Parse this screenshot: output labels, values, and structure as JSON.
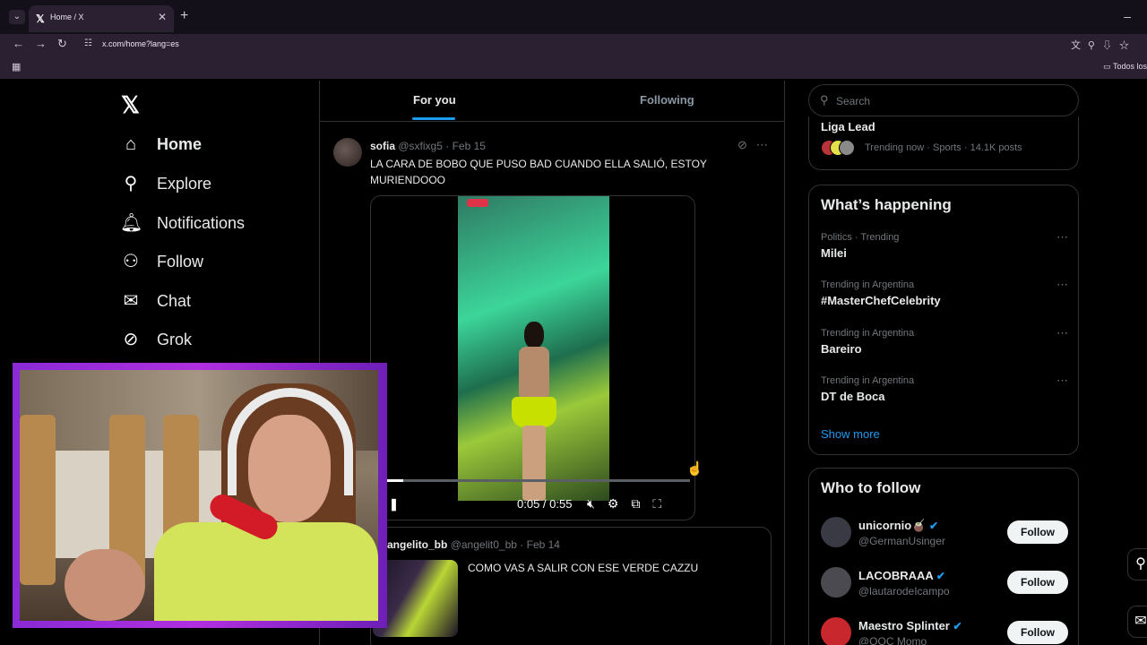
{
  "browser": {
    "tab_title": "Home / X",
    "tab_favicon": "𝕏",
    "url": "x.com/home?lang=es",
    "bookmark_folder": "Todos los",
    "icons": [
      "back-arrow-icon",
      "forward-arrow-icon",
      "reload-icon",
      "translate-icon",
      "zoom-icon",
      "install-icon",
      "star-icon",
      "apps-grid-icon",
      "folder-icon"
    ]
  },
  "nav": {
    "logo": "𝕏",
    "items": [
      {
        "label": "Home",
        "icon": "home-icon"
      },
      {
        "label": "Explore",
        "icon": "search-icon"
      },
      {
        "label": "Notifications",
        "icon": "bell-icon"
      },
      {
        "label": "Follow",
        "icon": "follow-icon"
      },
      {
        "label": "Chat",
        "icon": "mail-icon"
      },
      {
        "label": "Grok",
        "icon": "grok-icon"
      }
    ]
  },
  "feed": {
    "tabs": [
      "For you",
      "Following"
    ],
    "post": {
      "name": "sofia",
      "handle": "@sxfixg5",
      "date": "· Feb 15",
      "text": "LA CARA DE BOBO QUE PUSO BAD CUANDO ELLA SALIÓ, ESTOY MURIENDOOO",
      "video": {
        "time": "0:05 / 0:55",
        "progress": 0.06,
        "rec_time": "09:34"
      }
    },
    "quote": {
      "name": "angelito_bb",
      "handle": "@angelit0_bb",
      "date": "· Feb 14",
      "text": "COMO VAS A SALIR CON ESE VERDE CAZZU"
    }
  },
  "right": {
    "search_placeholder": "Search",
    "top_trend": {
      "title": "Liga Lead",
      "meta": "Trending now · Sports · 14.1K posts"
    },
    "happening": {
      "heading": "What’s happening",
      "trends": [
        {
          "context": "Politics · Trending",
          "name": "Milei"
        },
        {
          "context": "Trending in Argentina",
          "name": "#MasterChefCelebrity"
        },
        {
          "context": "Trending in Argentina",
          "name": "Bareiro"
        },
        {
          "context": "Trending in Argentina",
          "name": "DT de Boca"
        }
      ],
      "show_more": "Show more"
    },
    "who_to_follow": {
      "heading": "Who to follow",
      "button_label": "Follow",
      "accounts": [
        {
          "name": "unicornio🧉",
          "handle": "@GermanUsinger",
          "avatar_color": "#3a3a44"
        },
        {
          "name": "LACOBRAAA",
          "handle": "@lautarodeIcampo",
          "avatar_color": "#4a4a50"
        },
        {
          "name": "Maestro Splinter",
          "handle": "@OOC Momo",
          "avatar_color": "#c7272d"
        }
      ]
    }
  },
  "colors": {
    "accent": "#1d9bf0",
    "webcam_border": "#b02fe0"
  }
}
